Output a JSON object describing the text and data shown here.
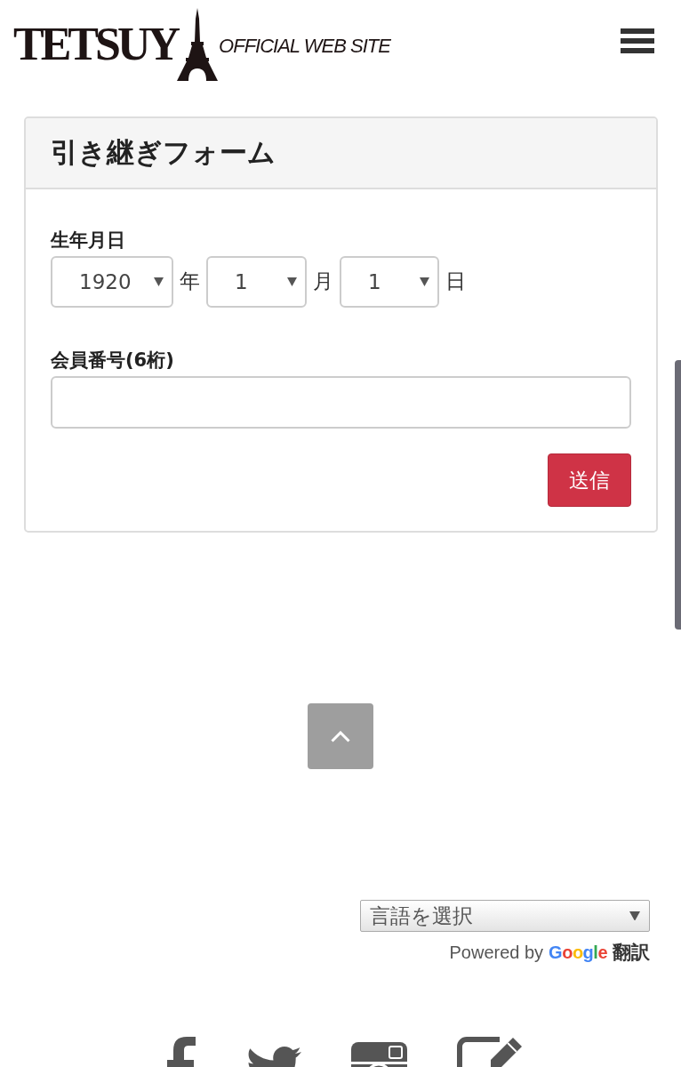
{
  "header": {
    "logo": {
      "wordmark": "TETSUY",
      "tagline": "OFFICIAL WEB SITE"
    }
  },
  "form": {
    "title": "引き継ぎフォーム",
    "fields": [
      {
        "kind": "date",
        "label": "生年月日",
        "parts": [
          {
            "value": "1920",
            "unit": "年"
          },
          {
            "value": "1",
            "unit": "月"
          },
          {
            "value": "1",
            "unit": "日"
          }
        ]
      },
      {
        "kind": "text",
        "label": "会員番号(6桁)"
      }
    ],
    "submit": "送信"
  },
  "translate": {
    "select": "言語を選択",
    "powered_by": "Powered by",
    "brand": "Google",
    "service": "翻訳"
  }
}
